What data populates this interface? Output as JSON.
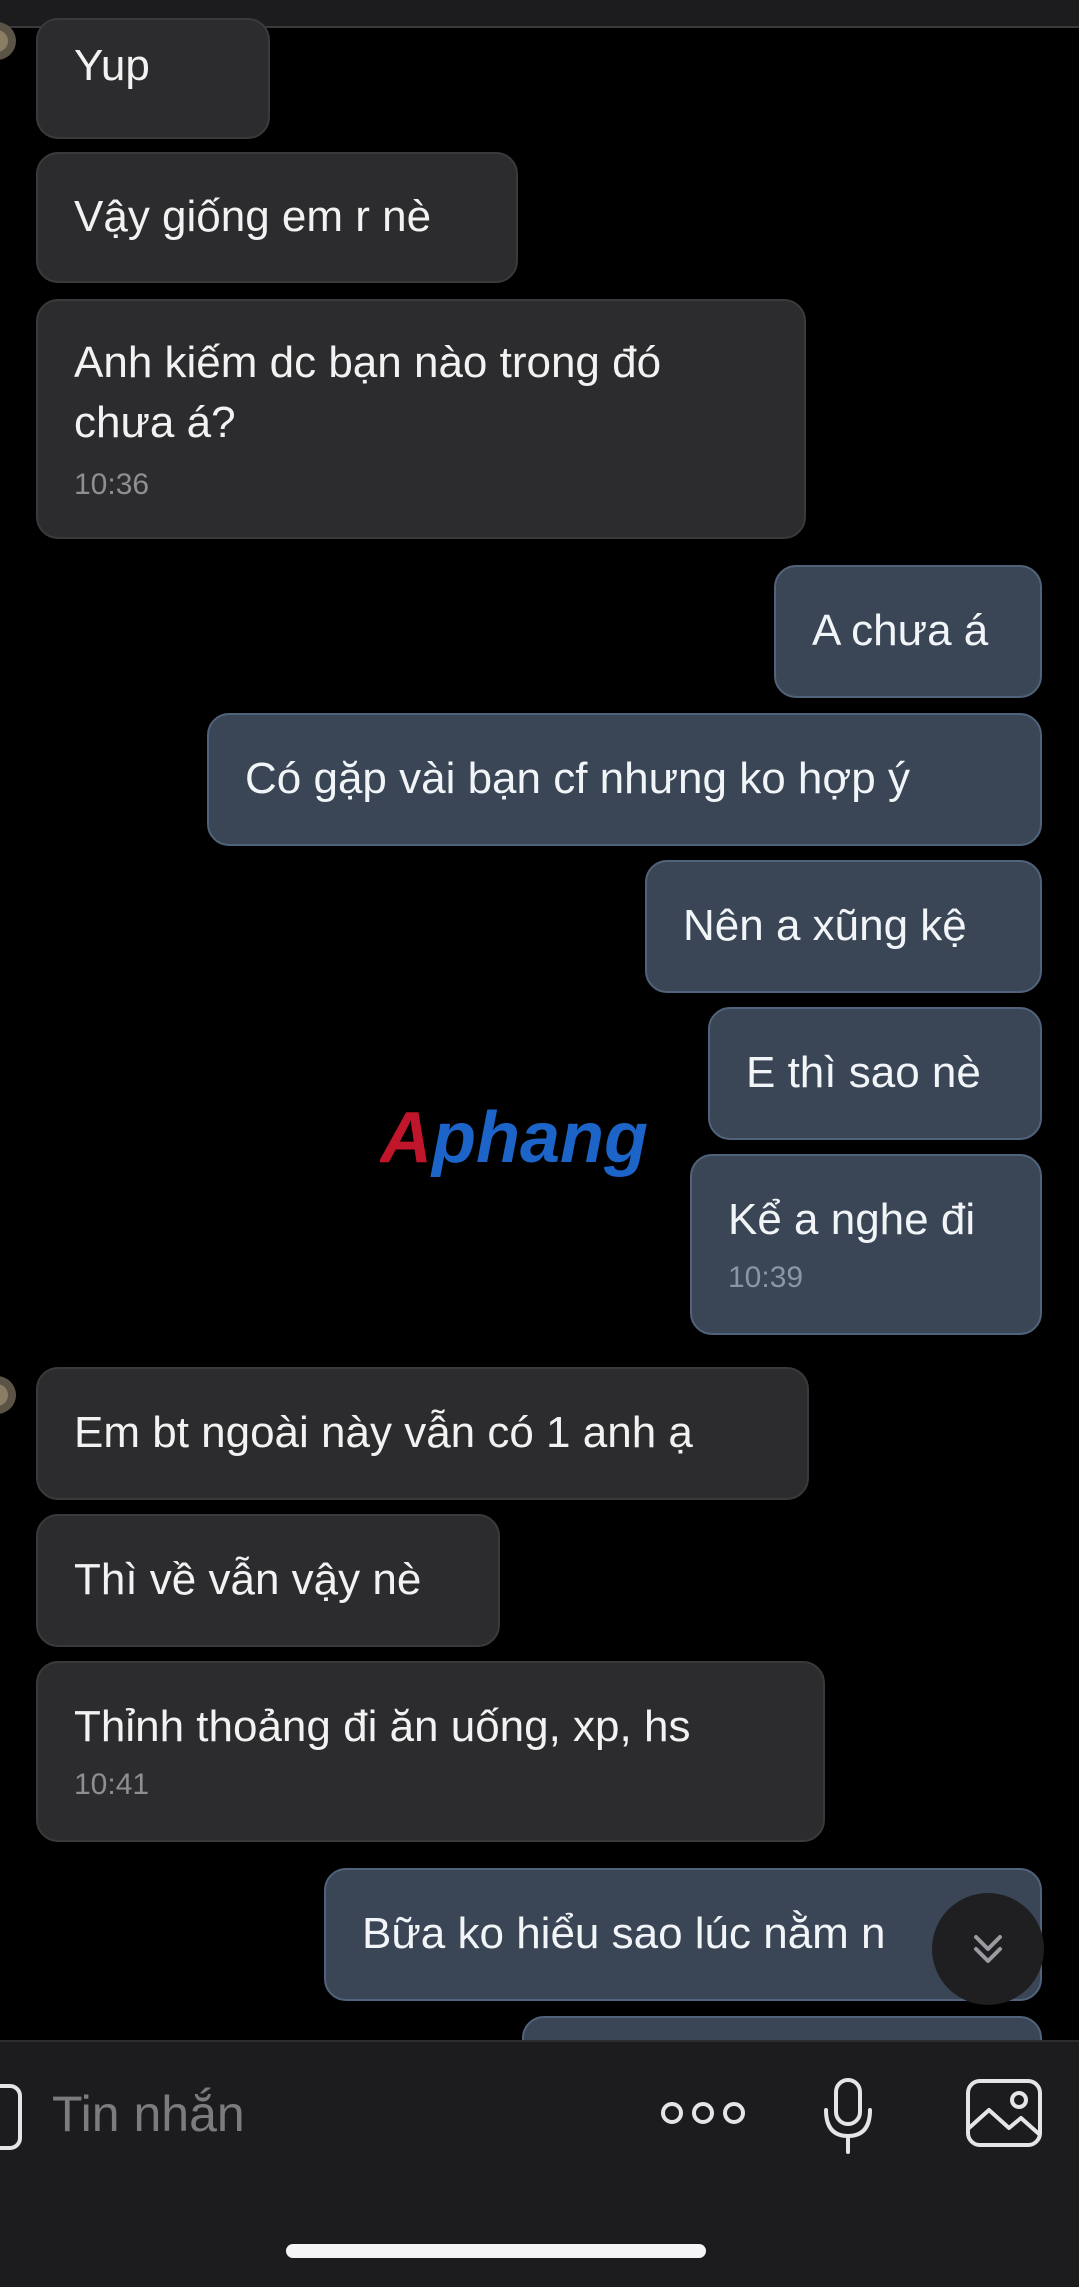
{
  "messages": [
    {
      "dir": "in",
      "text": "Yup"
    },
    {
      "dir": "in",
      "text": "Vậy giống em r nè"
    },
    {
      "dir": "in",
      "text": "Anh kiếm dc bạn nào trong đó\nchưa á?",
      "time": "10:36"
    },
    {
      "dir": "out",
      "text": "A chưa á"
    },
    {
      "dir": "out",
      "text": "Có gặp vài bạn cf nhưng ko hợp ý"
    },
    {
      "dir": "out",
      "text": "Nên a xũng kệ"
    },
    {
      "dir": "out",
      "text": "E thì sao nè"
    },
    {
      "dir": "out",
      "text": "Kể a nghe đi",
      "time": "10:39"
    },
    {
      "dir": "in",
      "text": "Em bt ngoài này vẫn có 1 anh ạ"
    },
    {
      "dir": "in",
      "text": "Thì về vẫn vậy nè"
    },
    {
      "dir": "in",
      "text": "Thỉnh thoảng đi ăn uống, xp, hs",
      "time": "10:41"
    },
    {
      "dir": "out",
      "text": "Bữa ko hiểu sao lúc nằm n"
    }
  ],
  "watermark": {
    "text": "Aphang"
  },
  "composer": {
    "placeholder": "Tin nhắn",
    "icons": [
      "sticker-icon",
      "more-icon",
      "microphone-icon",
      "gallery-icon"
    ]
  },
  "colors": {
    "background": "#000000",
    "incoming_bubble": "#2c2c2e",
    "outgoing_bubble": "#3a4656",
    "watermark_red": "#c0152b",
    "watermark_blue": "#1c64c8"
  }
}
